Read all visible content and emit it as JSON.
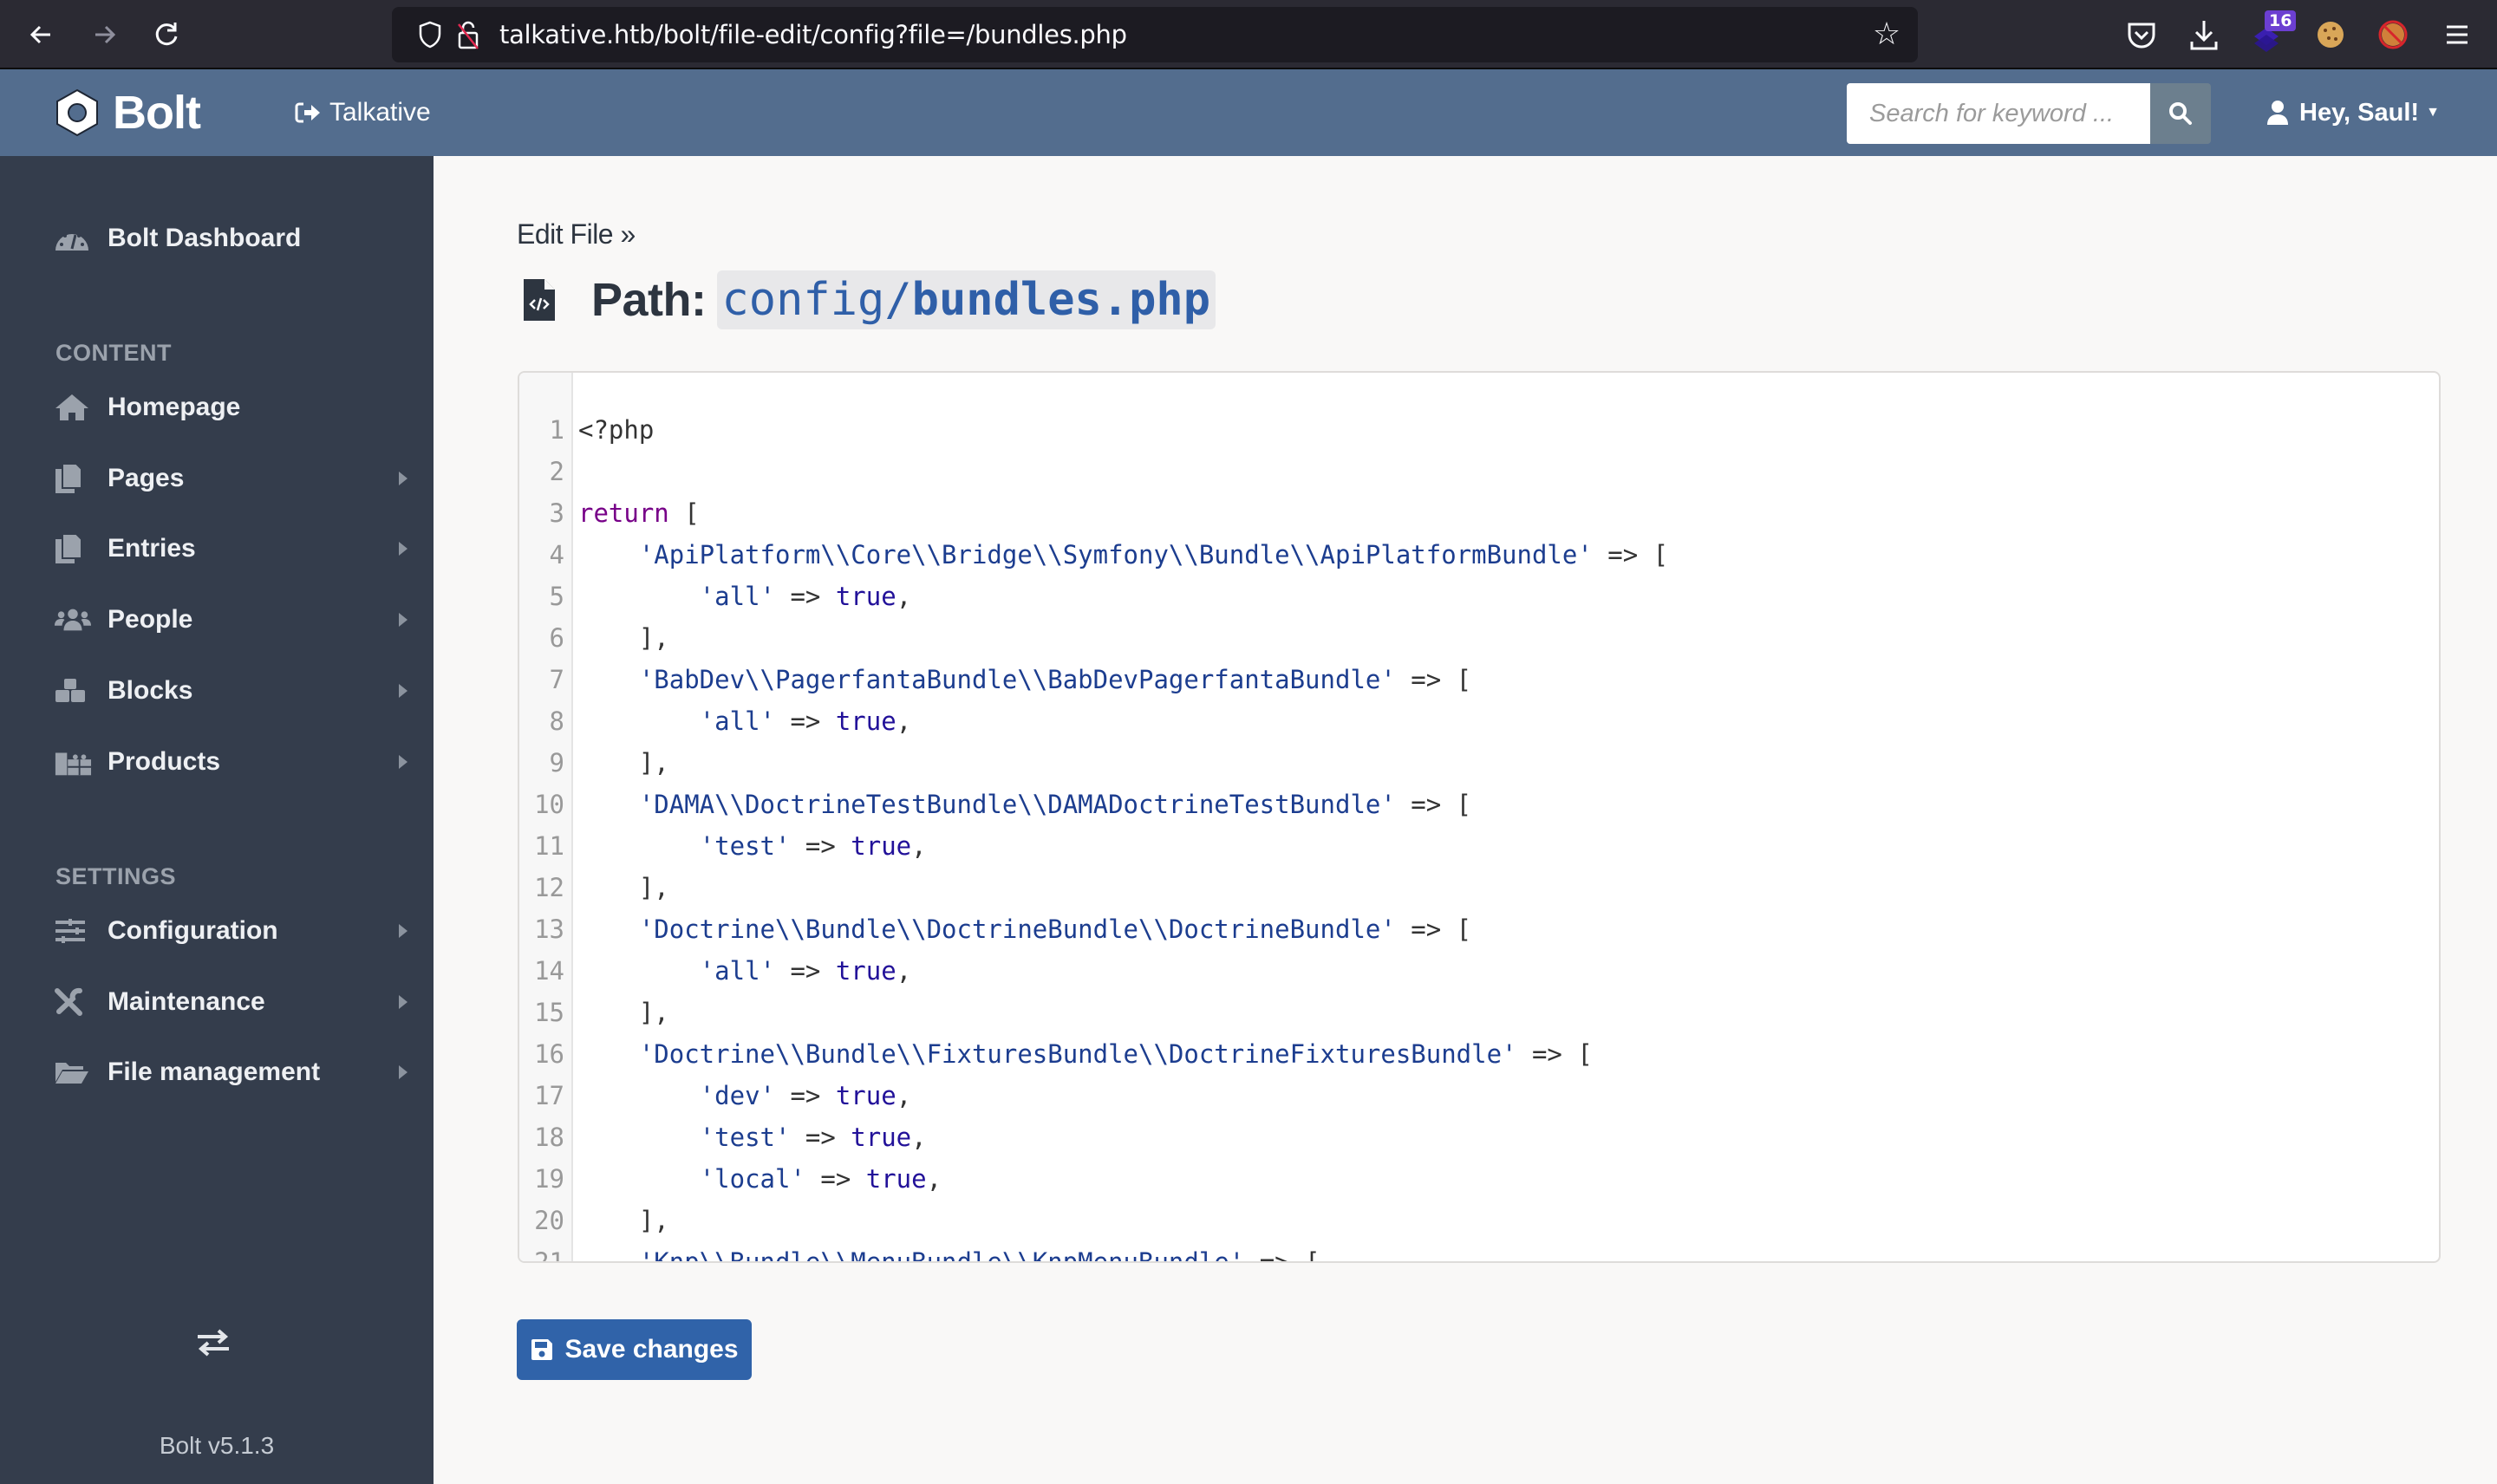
{
  "browser": {
    "url": "talkative.htb/bolt/file-edit/config?file=/bundles.php",
    "extension_badge": "16",
    "icons": [
      "back-icon",
      "forward-icon",
      "reload-icon",
      "shield-icon",
      "insecure-lock-icon",
      "bookmark-star-icon",
      "pocket-icon",
      "download-icon",
      "extension-icon",
      "cookie-icon",
      "blocked-fox-icon",
      "menu-icon"
    ]
  },
  "header": {
    "logo_text": "Bolt",
    "site_link": "Talkative",
    "search_placeholder": "Search for keyword ...",
    "user_label": "Hey, Saul!"
  },
  "sidebar": {
    "dashboard": "Bolt Dashboard",
    "content_heading": "CONTENT",
    "content_items": [
      {
        "label": "Homepage",
        "icon": "home-icon",
        "has_submenu": false
      },
      {
        "label": "Pages",
        "icon": "copy-icon",
        "has_submenu": true
      },
      {
        "label": "Entries",
        "icon": "copy-icon",
        "has_submenu": true
      },
      {
        "label": "People",
        "icon": "users-icon",
        "has_submenu": true
      },
      {
        "label": "Blocks",
        "icon": "cubes-icon",
        "has_submenu": true
      },
      {
        "label": "Products",
        "icon": "gifts-icon",
        "has_submenu": true
      }
    ],
    "settings_heading": "SETTINGS",
    "settings_items": [
      {
        "label": "Configuration",
        "icon": "sliders-icon",
        "has_submenu": true
      },
      {
        "label": "Maintenance",
        "icon": "tools-icon",
        "has_submenu": true
      },
      {
        "label": "File management",
        "icon": "folder-open-icon",
        "has_submenu": true
      }
    ],
    "version": "Bolt v5.1.3"
  },
  "main": {
    "breadcrumb": "Edit File »",
    "title_label": "Path:",
    "path_dir": "config/",
    "path_file": "bundles.php",
    "save_label": "Save changes",
    "code_lines": [
      [
        {
          "t": "<?php",
          "c": ""
        }
      ],
      [],
      [
        {
          "t": "return",
          "c": "kw"
        },
        {
          "t": " [",
          "c": ""
        }
      ],
      [
        {
          "t": "    ",
          "c": ""
        },
        {
          "t": "'ApiPlatform\\\\Core\\\\Bridge\\\\Symfony\\\\Bundle\\\\ApiPlatformBundle'",
          "c": "str"
        },
        {
          "t": " => [",
          "c": ""
        }
      ],
      [
        {
          "t": "        ",
          "c": ""
        },
        {
          "t": "'all'",
          "c": "str"
        },
        {
          "t": " => ",
          "c": ""
        },
        {
          "t": "true",
          "c": "atom"
        },
        {
          "t": ",",
          "c": ""
        }
      ],
      [
        {
          "t": "    ],",
          "c": ""
        }
      ],
      [
        {
          "t": "    ",
          "c": ""
        },
        {
          "t": "'BabDev\\\\PagerfantaBundle\\\\BabDevPagerfantaBundle'",
          "c": "str"
        },
        {
          "t": " => [",
          "c": ""
        }
      ],
      [
        {
          "t": "        ",
          "c": ""
        },
        {
          "t": "'all'",
          "c": "str"
        },
        {
          "t": " => ",
          "c": ""
        },
        {
          "t": "true",
          "c": "atom"
        },
        {
          "t": ",",
          "c": ""
        }
      ],
      [
        {
          "t": "    ],",
          "c": ""
        }
      ],
      [
        {
          "t": "    ",
          "c": ""
        },
        {
          "t": "'DAMA\\\\DoctrineTestBundle\\\\DAMADoctrineTestBundle'",
          "c": "str"
        },
        {
          "t": " => [",
          "c": ""
        }
      ],
      [
        {
          "t": "        ",
          "c": ""
        },
        {
          "t": "'test'",
          "c": "str"
        },
        {
          "t": " => ",
          "c": ""
        },
        {
          "t": "true",
          "c": "atom"
        },
        {
          "t": ",",
          "c": ""
        }
      ],
      [
        {
          "t": "    ],",
          "c": ""
        }
      ],
      [
        {
          "t": "    ",
          "c": ""
        },
        {
          "t": "'Doctrine\\\\Bundle\\\\DoctrineBundle\\\\DoctrineBundle'",
          "c": "str"
        },
        {
          "t": " => [",
          "c": ""
        }
      ],
      [
        {
          "t": "        ",
          "c": ""
        },
        {
          "t": "'all'",
          "c": "str"
        },
        {
          "t": " => ",
          "c": ""
        },
        {
          "t": "true",
          "c": "atom"
        },
        {
          "t": ",",
          "c": ""
        }
      ],
      [
        {
          "t": "    ],",
          "c": ""
        }
      ],
      [
        {
          "t": "    ",
          "c": ""
        },
        {
          "t": "'Doctrine\\\\Bundle\\\\FixturesBundle\\\\DoctrineFixturesBundle'",
          "c": "str"
        },
        {
          "t": " => [",
          "c": ""
        }
      ],
      [
        {
          "t": "        ",
          "c": ""
        },
        {
          "t": "'dev'",
          "c": "str"
        },
        {
          "t": " => ",
          "c": ""
        },
        {
          "t": "true",
          "c": "atom"
        },
        {
          "t": ",",
          "c": ""
        }
      ],
      [
        {
          "t": "        ",
          "c": ""
        },
        {
          "t": "'test'",
          "c": "str"
        },
        {
          "t": " => ",
          "c": ""
        },
        {
          "t": "true",
          "c": "atom"
        },
        {
          "t": ",",
          "c": ""
        }
      ],
      [
        {
          "t": "        ",
          "c": ""
        },
        {
          "t": "'local'",
          "c": "str"
        },
        {
          "t": " => ",
          "c": ""
        },
        {
          "t": "true",
          "c": "atom"
        },
        {
          "t": ",",
          "c": ""
        }
      ],
      [
        {
          "t": "    ],",
          "c": ""
        }
      ],
      [
        {
          "t": "    ",
          "c": ""
        },
        {
          "t": "'Knp\\\\Bundle\\\\MenuBundle\\\\KnpMenuBundle'",
          "c": "str"
        },
        {
          "t": " => [",
          "c": ""
        }
      ]
    ]
  },
  "colors": {
    "header_bg": "#536d8e",
    "sidebar_bg": "#343d4c",
    "content_bg": "#f9f8f7",
    "primary_button": "#3063a9",
    "path_text": "#2f5fa8"
  }
}
